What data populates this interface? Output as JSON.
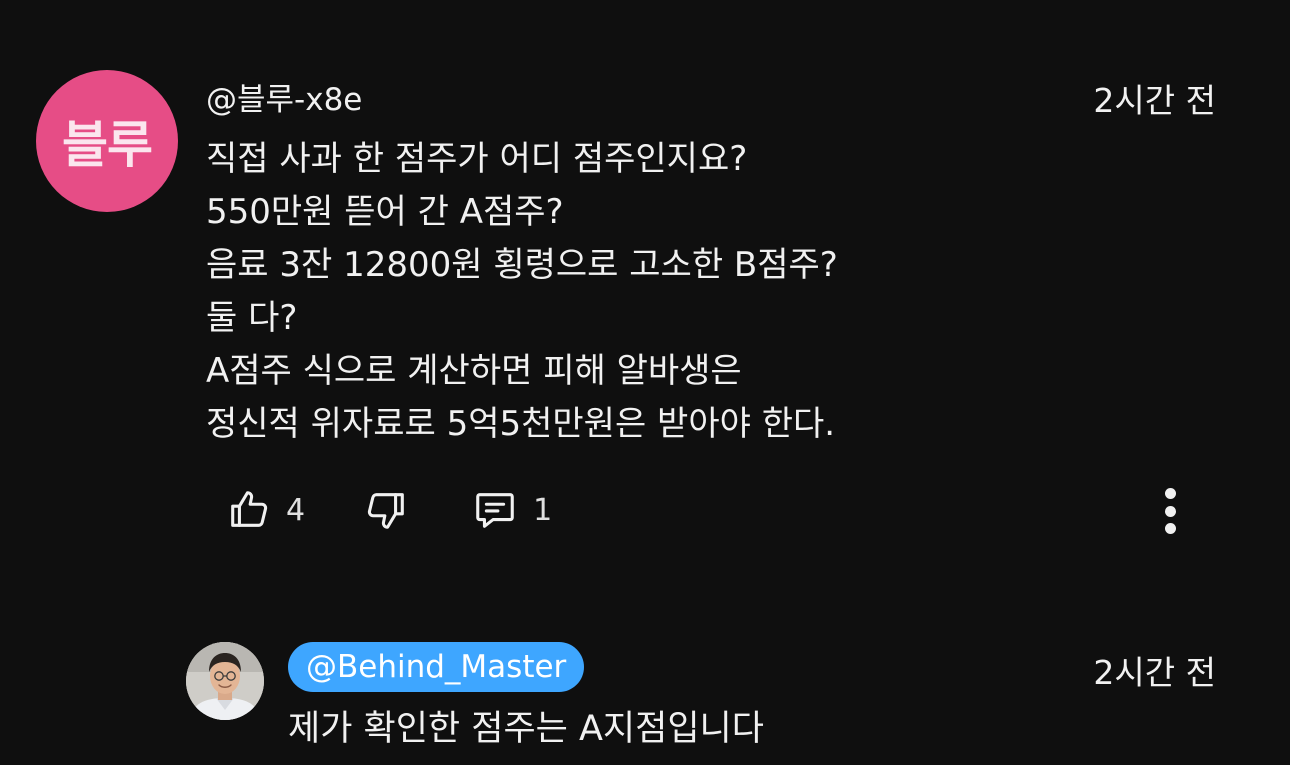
{
  "comment": {
    "avatar_text": "블루",
    "avatar_color": "#e64d86",
    "handle": "@블루-x8e",
    "time": "2시간 전",
    "lines": [
      "직접 사과 한 점주가 어디 점주인지요?",
      "550만원 뜯어 간 A점주?",
      "음료 3잔 12800원 횡령으로 고소한 B점주?",
      "둘 다?",
      "A점주 식으로 계산하면 피해 알바생은",
      "정신적 위자료로 5억5천만원은 받아야 한다."
    ],
    "actions": {
      "like_icon": "thumbs-up-icon",
      "like_count": "4",
      "dislike_icon": "thumbs-down-icon",
      "reply_icon": "comment-icon",
      "reply_count": "1",
      "more_icon": "more-vertical-icon"
    }
  },
  "reply": {
    "avatar": "profile-photo",
    "handle": "@Behind_Master",
    "handle_highlight_color": "#3ea6ff",
    "time": "2시간 전",
    "text": "제가 확인한 점주는 A지점입니다"
  }
}
